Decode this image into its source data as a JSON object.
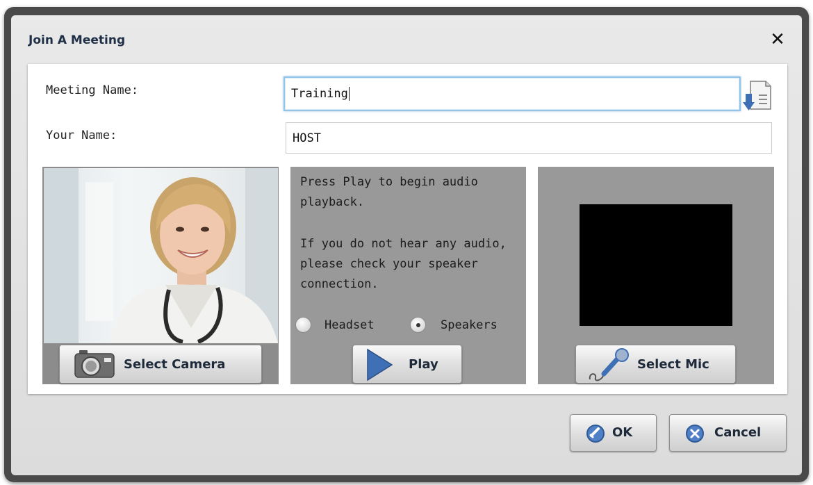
{
  "dialog": {
    "title": "Join A Meeting",
    "close_symbol": "✕"
  },
  "form": {
    "meeting_name_label": "Meeting Name:",
    "meeting_name_value": "Training",
    "your_name_label": "Your Name:",
    "your_name_value": "HOST"
  },
  "camera": {
    "select_label": "Select Camera",
    "icon": "camera-icon"
  },
  "audio": {
    "instructions_1": "Press Play to begin audio playback.",
    "instructions_2": "If you do not hear any audio, please check your speaker connection.",
    "options": [
      {
        "label": "Headset",
        "selected": false
      },
      {
        "label": "Speakers",
        "selected": true
      }
    ],
    "play_label": "Play",
    "icon": "play-icon"
  },
  "mic": {
    "select_label": "Select Mic",
    "icon": "microphone-icon"
  },
  "footer": {
    "ok_label": "OK",
    "cancel_label": "Cancel"
  },
  "colors": {
    "frame": "#4a4a4a",
    "panel": "#999999",
    "accent": "#3f6fb5",
    "title_text": "#1f2f45"
  }
}
